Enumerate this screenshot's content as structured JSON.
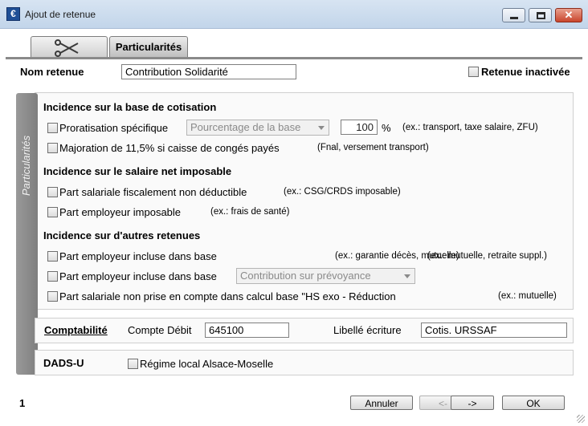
{
  "window": {
    "title": "Ajout de retenue",
    "app_icon_glyph": "€"
  },
  "tabs": [
    {
      "label": "",
      "icon": "scissors-icon"
    },
    {
      "label": "Particularités"
    }
  ],
  "header": {
    "nom_retenue_label": "Nom retenue",
    "nom_retenue_value": "Contribution Solidarité",
    "retenue_inactivee_label": "Retenue inactivée",
    "retenue_inactivee_checked": false
  },
  "particularites": {
    "side_label": "Particularités",
    "base_cotisation": {
      "heading": "Incidence sur la base de cotisation",
      "proratisation_label": "Proratisation spécifique",
      "proratisation_combo": "Pourcentage de la base",
      "pourcentage_value": "100",
      "pourcentage_unit": "%",
      "proratisation_hint": "(ex.: transport, taxe salaire, ZFU)",
      "majoration_label": "Majoration de 11,5% si caisse de congés payés",
      "majoration_hint": "(Fnal, versement transport)"
    },
    "salaire_net": {
      "heading": "Incidence sur le salaire net imposable",
      "part_salariale_label": "Part salariale fiscalement non déductible",
      "part_salariale_hint": "(ex.: CSG/CRDS imposable)",
      "part_employeur_label": "Part employeur imposable",
      "part_employeur_hint": "(ex.: frais de santé)"
    },
    "autres_retenues": {
      "heading": "Incidence sur d'autres retenues",
      "incluse_base_1_label": "Part employeur incluse dans base",
      "incluse_base_1_hint_a": "(ex.: garantie décès, mutuelle)",
      "incluse_base_1_hint_b": "(ex.: mutuelle, retraite suppl.)",
      "incluse_base_2_label": "Part employeur incluse dans base",
      "incluse_base_2_combo": "Contribution sur prévoyance",
      "non_prise_label": "Part salariale non prise en compte dans calcul base \"HS exo - Réduction",
      "non_prise_hint": "(ex.: mutuelle)"
    }
  },
  "comptabilite": {
    "heading": "Comptabilité",
    "compte_debit_label": "Compte Débit",
    "compte_debit_value": "645100",
    "libelle_label": "Libellé écriture",
    "libelle_value": "Cotis. URSSAF"
  },
  "dads": {
    "heading": "DADS-U",
    "regime_label": "Régime local Alsace-Moselle"
  },
  "footer": {
    "page_number": "1",
    "annuler_label": "Annuler",
    "prev_label": "<-",
    "next_label": "->",
    "ok_label": "OK"
  }
}
